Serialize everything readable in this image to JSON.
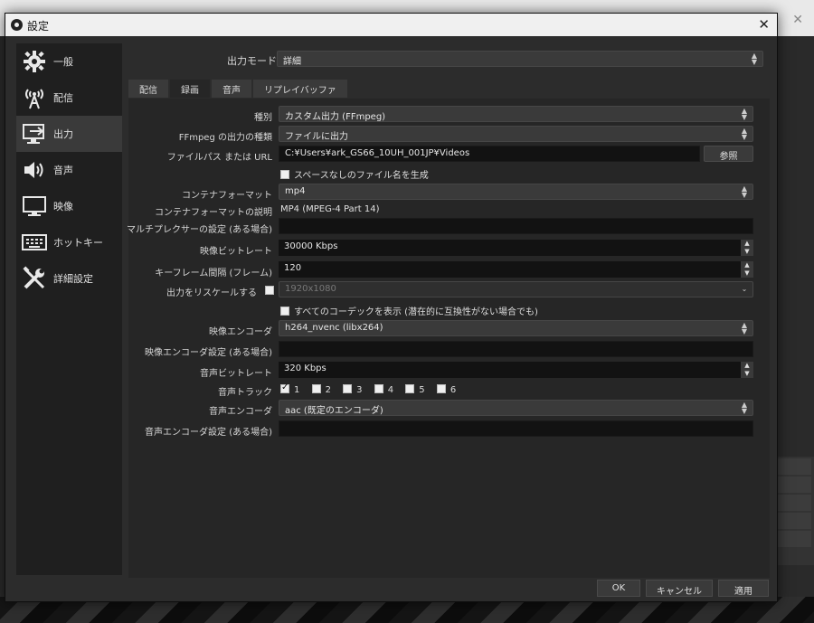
{
  "window": {
    "title": "設定"
  },
  "sidebar": {
    "items": [
      {
        "label": "一般",
        "icon": "gear-icon"
      },
      {
        "label": "配信",
        "icon": "broadcast-icon"
      },
      {
        "label": "出力",
        "icon": "monitor-output-icon",
        "active": true
      },
      {
        "label": "音声",
        "icon": "speaker-icon"
      },
      {
        "label": "映像",
        "icon": "display-icon"
      },
      {
        "label": "ホットキー",
        "icon": "keyboard-icon"
      },
      {
        "label": "詳細設定",
        "icon": "tools-icon"
      }
    ]
  },
  "output_mode": {
    "label": "出力モード",
    "value": "詳細"
  },
  "tabs": [
    {
      "label": "配信"
    },
    {
      "label": "録画",
      "active": true
    },
    {
      "label": "音声"
    },
    {
      "label": "リプレイバッファ"
    }
  ],
  "recording": {
    "type": {
      "label": "種別",
      "value": "カスタム出力 (FFmpeg)"
    },
    "ffmpeg_output_type": {
      "label": "FFmpeg の出力の種類",
      "value": "ファイルに出力"
    },
    "file_path": {
      "label": "ファイルパス または URL",
      "value": "C:¥Users¥ark_GS66_10UH_001JP¥Videos",
      "browse": "参照"
    },
    "no_space_filename": {
      "label": "スペースなしのファイル名を生成",
      "checked": false
    },
    "container_format": {
      "label": "コンテナフォーマット",
      "value": "mp4"
    },
    "container_desc": {
      "label": "コンテナフォーマットの説明",
      "value": "MP4 (MPEG-4 Part 14)"
    },
    "muxer_settings": {
      "label": "マルチプレクサーの設定 (ある場合)",
      "value": ""
    },
    "video_bitrate": {
      "label": "映像ビットレート",
      "value": "30000 Kbps"
    },
    "keyframe_interval": {
      "label": "キーフレーム間隔 (フレーム)",
      "value": "120"
    },
    "rescale": {
      "label": "出力をリスケールする",
      "checked": false,
      "value": "1920x1080"
    },
    "show_all_codecs": {
      "label": "すべてのコーデックを表示 (潜在的に互換性がない場合でも)",
      "checked": false
    },
    "video_encoder": {
      "label": "映像エンコーダ",
      "value": "h264_nvenc (libx264)"
    },
    "video_encoder_settings": {
      "label": "映像エンコーダ設定 (ある場合)",
      "value": ""
    },
    "audio_bitrate": {
      "label": "音声ビットレート",
      "value": "320 Kbps"
    },
    "audio_track": {
      "label": "音声トラック",
      "tracks": [
        {
          "num": "1",
          "checked": true
        },
        {
          "num": "2",
          "checked": false
        },
        {
          "num": "3",
          "checked": false
        },
        {
          "num": "4",
          "checked": false
        },
        {
          "num": "5",
          "checked": false
        },
        {
          "num": "6",
          "checked": false
        }
      ]
    },
    "audio_encoder": {
      "label": "音声エンコーダ",
      "value": "aac (既定のエンコーダ)"
    },
    "audio_encoder_settings": {
      "label": "音声エンコーダ設定 (ある場合)",
      "value": ""
    }
  },
  "footer": {
    "ok": "OK",
    "cancel": "キャンセル",
    "apply": "適用"
  },
  "colors": {
    "dialog_bg": "#2c2c2c",
    "panel_bg": "#262626",
    "sidebar_bg": "#1f1f1f",
    "input_bg": "#121212"
  }
}
